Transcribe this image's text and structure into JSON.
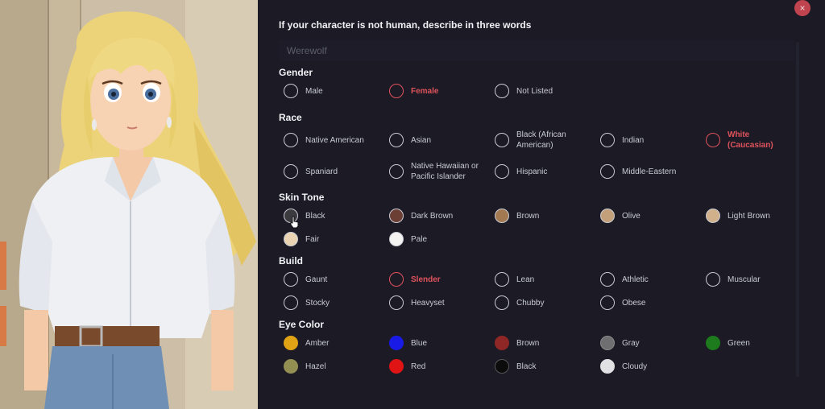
{
  "question": "If your character is not human, describe in three words",
  "nonhuman_input": {
    "placeholder": "Werewolf",
    "value": ""
  },
  "close_label": "×",
  "gender": {
    "title": "Gender",
    "options": [
      "Male",
      "Female",
      "Not Listed"
    ],
    "selected": "Female"
  },
  "race": {
    "title": "Race",
    "options": [
      "Native American",
      "Asian",
      "Black (African American)",
      "Indian",
      "White (Caucasian)",
      "Spaniard",
      "Native Hawaiian or Pacific Islander",
      "Hispanic",
      "Middle-Eastern"
    ],
    "selected": "White (Caucasian)"
  },
  "skin_tone": {
    "title": "Skin Tone",
    "options": [
      {
        "label": "Black",
        "color": "#3a3a3f"
      },
      {
        "label": "Dark Brown",
        "color": "#6b3f33"
      },
      {
        "label": "Brown",
        "color": "#a27950"
      },
      {
        "label": "Olive",
        "color": "#c4a07a"
      },
      {
        "label": "Light Brown",
        "color": "#d1b08c"
      },
      {
        "label": "Fair",
        "color": "#e9d3b3"
      },
      {
        "label": "Pale",
        "color": "#f4f3f1"
      }
    ]
  },
  "build": {
    "title": "Build",
    "options": [
      "Gaunt",
      "Slender",
      "Lean",
      "Athletic",
      "Muscular",
      "Stocky",
      "Heavyset",
      "Chubby",
      "Obese"
    ],
    "selected": "Slender"
  },
  "eye_color": {
    "title": "Eye Color",
    "options": [
      {
        "label": "Amber",
        "color": "#e0a316"
      },
      {
        "label": "Blue",
        "color": "#1a1ae6"
      },
      {
        "label": "Brown",
        "color": "#8f2727"
      },
      {
        "label": "Gray",
        "color": "#6f6f72"
      },
      {
        "label": "Green",
        "color": "#1d7a1d"
      },
      {
        "label": "Hazel",
        "color": "#938f53"
      },
      {
        "label": "Red",
        "color": "#e01414"
      },
      {
        "label": "Black",
        "color": "#0c0c0c"
      },
      {
        "label": "Cloudy",
        "color": "#e1e1e3"
      }
    ]
  }
}
